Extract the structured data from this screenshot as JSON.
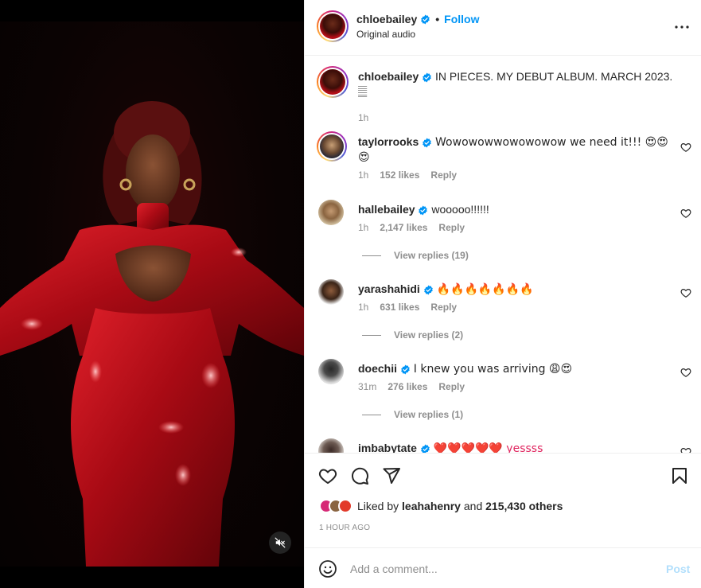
{
  "post": {
    "author": "chloebailey",
    "follow_label": "Follow",
    "separator": "•",
    "audio_label": "Original audio",
    "caption": "IN PIECES. MY DEBUT ALBUM. MARCH 2023.",
    "caption_extra": "𝄛",
    "caption_time": "1h"
  },
  "comments": [
    {
      "user": "taylorrooks",
      "text": "Wowowowwowowowow we need it!!! 😍😍",
      "text2": "😍",
      "time": "1h",
      "likes": "152 likes",
      "reply": "Reply"
    },
    {
      "user": "hallebailey",
      "text": "wooooo!!!!!!",
      "time": "1h",
      "likes": "2,147 likes",
      "reply": "Reply",
      "view_replies": "View replies (19)"
    },
    {
      "user": "yarashahidi",
      "text": "🔥🔥🔥🔥🔥🔥🔥",
      "time": "1h",
      "likes": "631 likes",
      "reply": "Reply",
      "view_replies": "View replies (2)"
    },
    {
      "user": "doechii",
      "text": "I knew you was arriving 😩😍",
      "time": "31m",
      "likes": "276 likes",
      "reply": "Reply",
      "view_replies": "View replies (1)"
    },
    {
      "user": "imbabytate",
      "text": "❤️❤️❤️❤️❤️ yessss"
    }
  ],
  "likes": {
    "prefix": "Liked by",
    "user": "leahahenry",
    "conj": "and",
    "others": "215,430 others"
  },
  "time_ago": "1 HOUR AGO",
  "composer": {
    "placeholder": "Add a comment...",
    "post_label": "Post"
  },
  "colors": {
    "accent": "#0095f6",
    "post_disabled": "#b2dffc",
    "muted": "#8e8e8e"
  },
  "icons": [
    "mute-icon",
    "more-icon",
    "verified-icon",
    "heart-icon",
    "comment-icon",
    "share-icon",
    "bookmark-icon",
    "emoji-icon"
  ]
}
